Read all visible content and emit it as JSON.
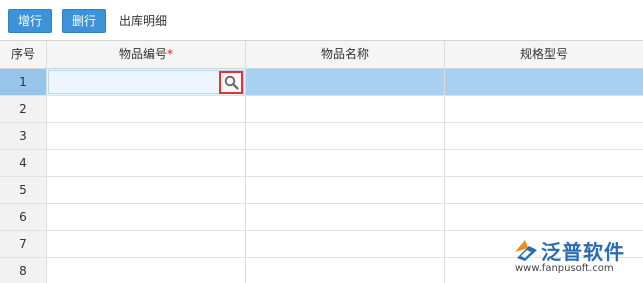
{
  "toolbar": {
    "add_row_label": "增行",
    "delete_row_label": "删行",
    "section_title": "出库明细"
  },
  "table": {
    "columns": [
      "序号",
      "物品编号",
      "物品名称",
      "规格型号"
    ],
    "required_mark": "*",
    "rows": [
      {
        "index": "1",
        "item_code": "",
        "item_name": "",
        "spec": ""
      },
      {
        "index": "2",
        "item_code": "",
        "item_name": "",
        "spec": ""
      },
      {
        "index": "3",
        "item_code": "",
        "item_name": "",
        "spec": ""
      },
      {
        "index": "4",
        "item_code": "",
        "item_name": "",
        "spec": ""
      },
      {
        "index": "5",
        "item_code": "",
        "item_name": "",
        "spec": ""
      },
      {
        "index": "6",
        "item_code": "",
        "item_name": "",
        "spec": ""
      },
      {
        "index": "7",
        "item_code": "",
        "item_name": "",
        "spec": ""
      },
      {
        "index": "8",
        "item_code": "",
        "item_name": "",
        "spec": ""
      }
    ],
    "selected_row": "1",
    "lookup_icon": "search-icon"
  },
  "watermark": {
    "brand": "泛普软件",
    "url": "www.fanpusoft.com"
  },
  "colors": {
    "button": "#3d92d8",
    "selected_row": "#a8d1f1",
    "highlight_border": "#e53333",
    "brand": "#2b6cb0"
  }
}
